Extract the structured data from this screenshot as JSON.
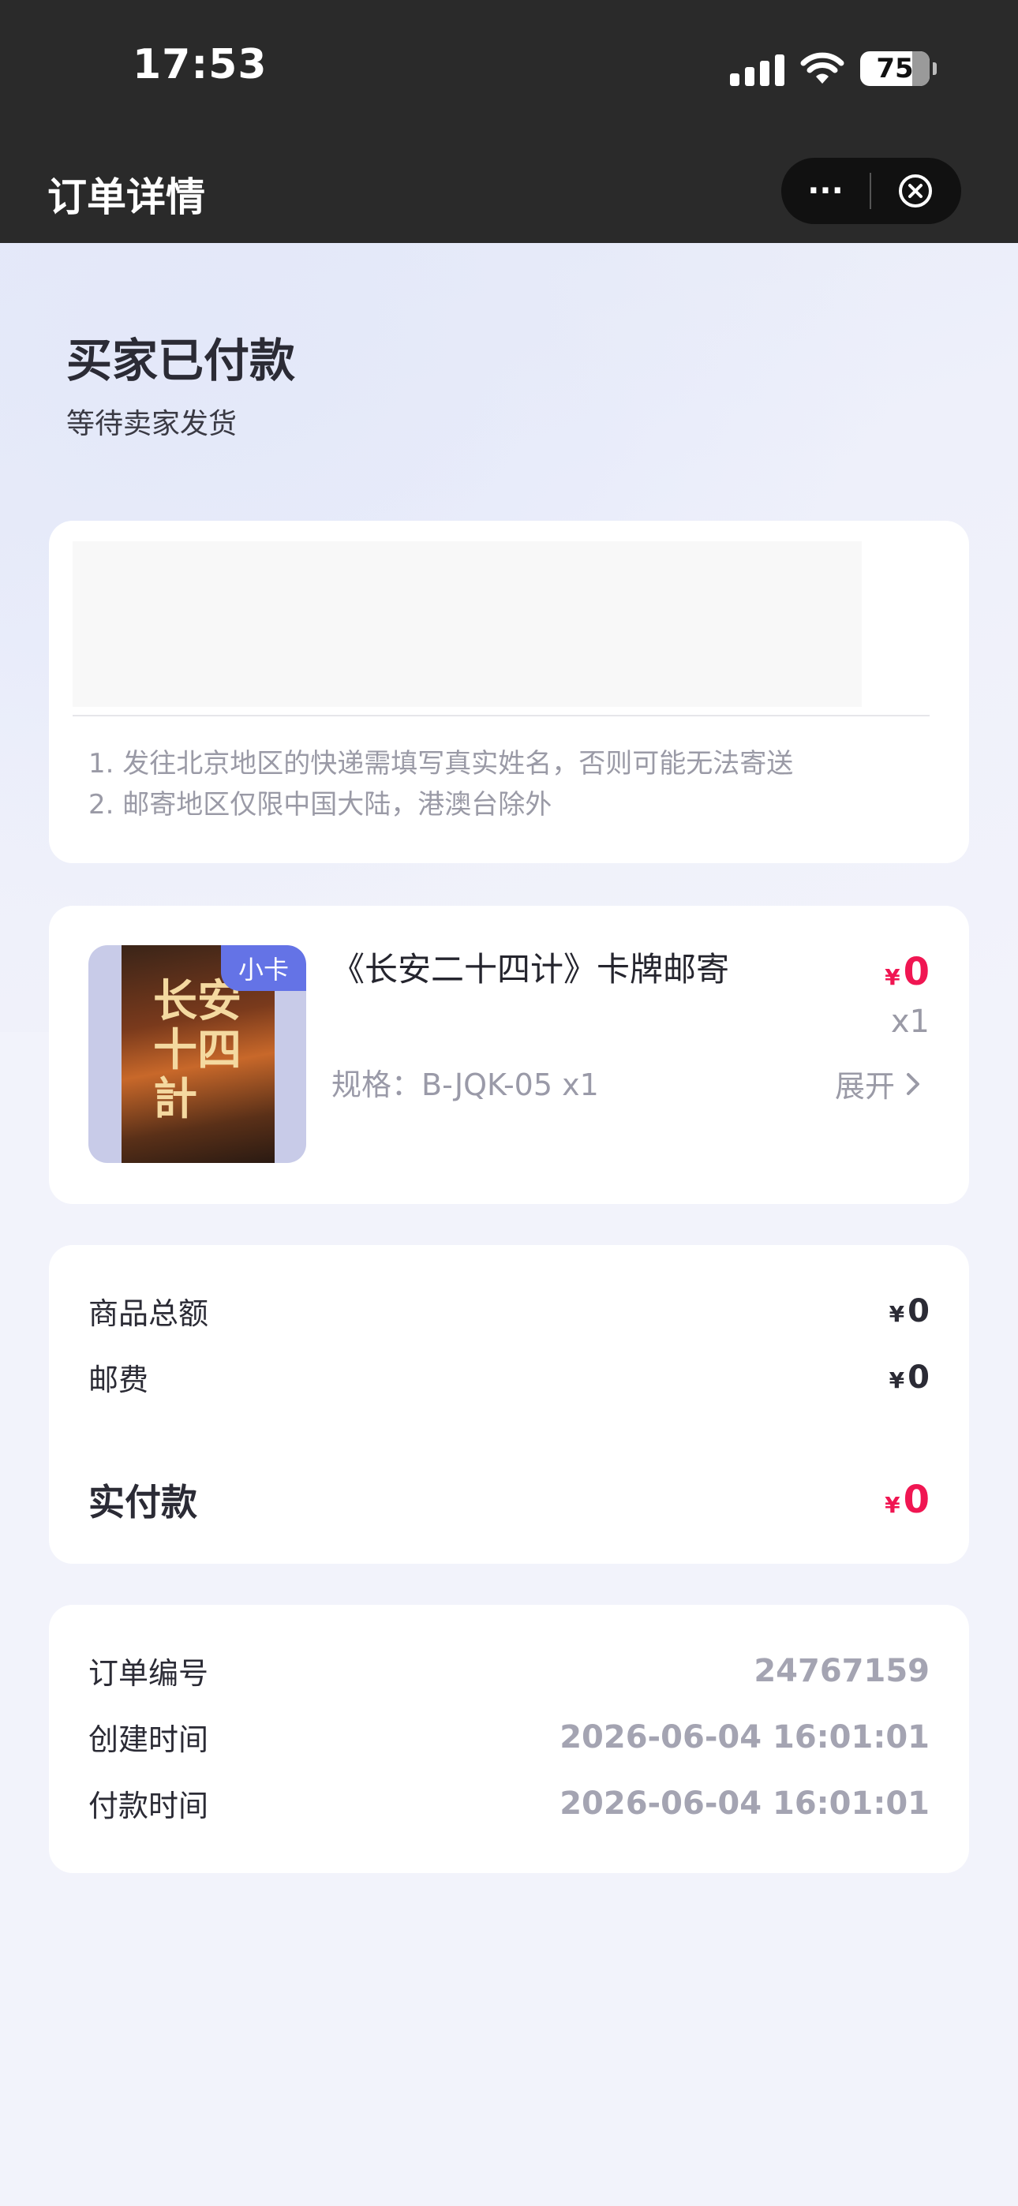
{
  "status_bar": {
    "time": "17:53",
    "battery": "75"
  },
  "nav": {
    "title": "订单详情",
    "more_label": "···"
  },
  "order_status": {
    "title": "买家已付款",
    "subtitle": "等待卖家发货"
  },
  "address_card": {
    "notices": [
      "1. 发往北京地区的快递需填写真实姓名，否则可能无法寄送",
      "2. 邮寄地区仅限中国大陆，港澳台除外"
    ]
  },
  "product": {
    "tag": "小卡",
    "cover_text": "长安十四計",
    "name": "《长安二十四计》卡牌邮寄",
    "spec": "规格：B-JQK-05 x1",
    "currency": "¥",
    "price": "0",
    "quantity": "x1",
    "expand_label": "展开"
  },
  "summary": {
    "rows": [
      {
        "label": "商品总额",
        "currency": "¥",
        "value": "0"
      },
      {
        "label": "邮费",
        "currency": "¥",
        "value": "0"
      }
    ],
    "total": {
      "label": "实付款",
      "currency": "¥",
      "value": "0"
    }
  },
  "order_info": {
    "rows": [
      {
        "label": "订单编号",
        "value": "24767159"
      },
      {
        "label": "创建时间",
        "value": "2026-06-04 16:01:01"
      },
      {
        "label": "付款时间",
        "value": "2026-06-04 16:01:01"
      }
    ]
  },
  "colors": {
    "accent_red": "#f01652",
    "tag_blue": "#6473e6",
    "topbar": "#2a2a2a"
  }
}
